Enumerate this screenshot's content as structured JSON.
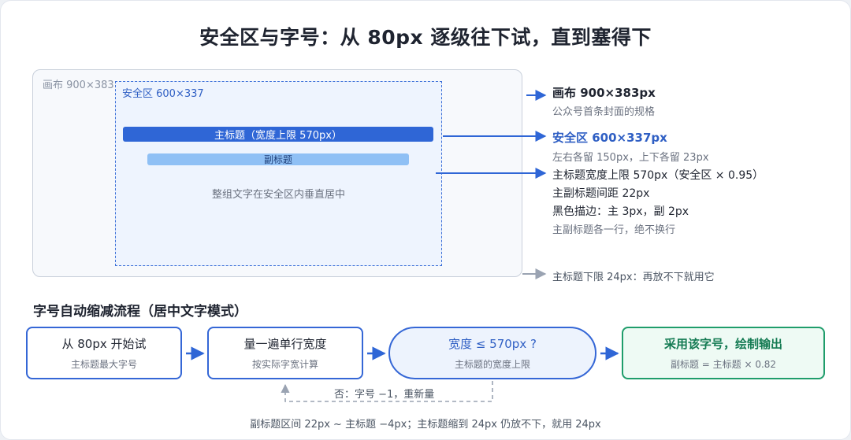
{
  "title": "安全区与字号：从 80px 逐级往下试，直到塞得下",
  "canvas": {
    "label": "画布 900×383",
    "safe_label": "安全区 600×337",
    "main_bar": "主标题（宽度上限 570px）",
    "sub_bar": "副标题",
    "center_note": "整组文字在安全区内垂直居中"
  },
  "annotations": {
    "canvas_title": "画布 900×383px",
    "canvas_sub": "公众号首条封面的规格",
    "safe_title": "安全区 600×337px",
    "safe_sub": "左右各留 150px，上下各留 23px",
    "main_lines": [
      "主标题宽度上限 570px（安全区 × 0.95）",
      "主副标题间距 22px",
      "黑色描边：主 3px，副 2px"
    ],
    "main_sub": "主副标题各一行，绝不换行",
    "min_note": "主标题下限 24px：再放不下就用它"
  },
  "flow": {
    "section_title": "字号自动缩减流程（居中文字模式）",
    "steps": [
      {
        "title": "从 80px 开始试",
        "sub": "主标题最大字号"
      },
      {
        "title": "量一遍单行宽度",
        "sub": "按实际字宽计算"
      },
      {
        "title": "宽度 ≤ 570px ?",
        "sub": "主标题的宽度上限"
      },
      {
        "title": "采用该字号，绘制输出",
        "sub": "副标题 = 主标题 × 0.82"
      }
    ],
    "retry": "否：字号 −1，重新量",
    "footer": "副标题区间 22px ~ 主标题 −4px；主标题缩到 24px 仍放不下，就用 24px"
  },
  "colors": {
    "accent_blue": "#3567d6",
    "success_green": "#1f9d6b",
    "muted_gray": "#9aa3b2"
  }
}
